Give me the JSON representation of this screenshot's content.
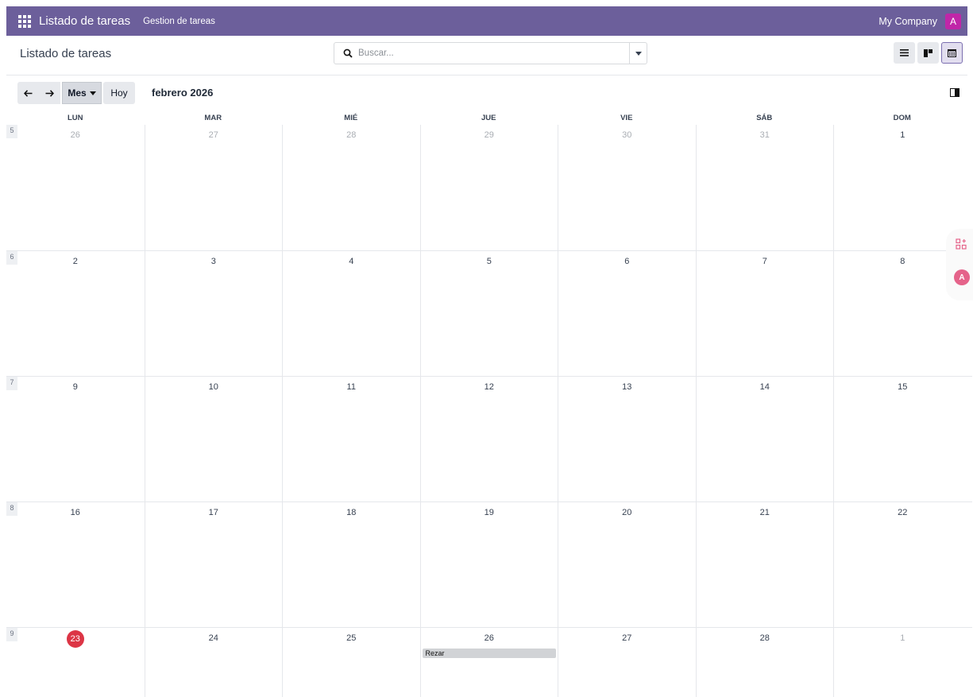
{
  "navbar": {
    "app_title": "Listado de tareas",
    "menu_item": "Gestion de tareas",
    "company": "My Company",
    "avatar_initial": "A"
  },
  "control_panel": {
    "breadcrumb": "Listado de tareas",
    "search_placeholder": "Buscar...",
    "views": [
      "list-view-icon",
      "kanban-view-icon",
      "calendar-view-icon"
    ],
    "active_view": "calendar"
  },
  "calendar_toolbar": {
    "scale_label": "Mes",
    "today_label": "Hoy",
    "range_title": "febrero 2026"
  },
  "calendar": {
    "weekdays": [
      "LUN",
      "MAR",
      "MIÉ",
      "JUE",
      "VIE",
      "SÁB",
      "DOM"
    ],
    "weeks": [
      {
        "number": "5",
        "days": [
          {
            "n": "26",
            "muted": true
          },
          {
            "n": "27",
            "muted": true
          },
          {
            "n": "28",
            "muted": true
          },
          {
            "n": "29",
            "muted": true
          },
          {
            "n": "30",
            "muted": true
          },
          {
            "n": "31",
            "muted": true
          },
          {
            "n": "1",
            "muted": false
          }
        ]
      },
      {
        "number": "6",
        "days": [
          {
            "n": "2"
          },
          {
            "n": "3"
          },
          {
            "n": "4"
          },
          {
            "n": "5"
          },
          {
            "n": "6"
          },
          {
            "n": "7"
          },
          {
            "n": "8"
          }
        ]
      },
      {
        "number": "7",
        "days": [
          {
            "n": "9"
          },
          {
            "n": "10"
          },
          {
            "n": "11"
          },
          {
            "n": "12"
          },
          {
            "n": "13"
          },
          {
            "n": "14"
          },
          {
            "n": "15"
          }
        ]
      },
      {
        "number": "8",
        "days": [
          {
            "n": "16"
          },
          {
            "n": "17"
          },
          {
            "n": "18"
          },
          {
            "n": "19"
          },
          {
            "n": "20"
          },
          {
            "n": "21"
          },
          {
            "n": "22"
          }
        ]
      },
      {
        "number": "9",
        "days": [
          {
            "n": "23",
            "today": true
          },
          {
            "n": "24"
          },
          {
            "n": "25"
          },
          {
            "n": "26",
            "event": "Rezar"
          },
          {
            "n": "27"
          },
          {
            "n": "28"
          },
          {
            "n": "1",
            "muted": true
          }
        ]
      }
    ],
    "today_color": "#dc3545"
  },
  "colors": {
    "navbar": "#6c5f9b",
    "avatar": "#c026a8"
  }
}
